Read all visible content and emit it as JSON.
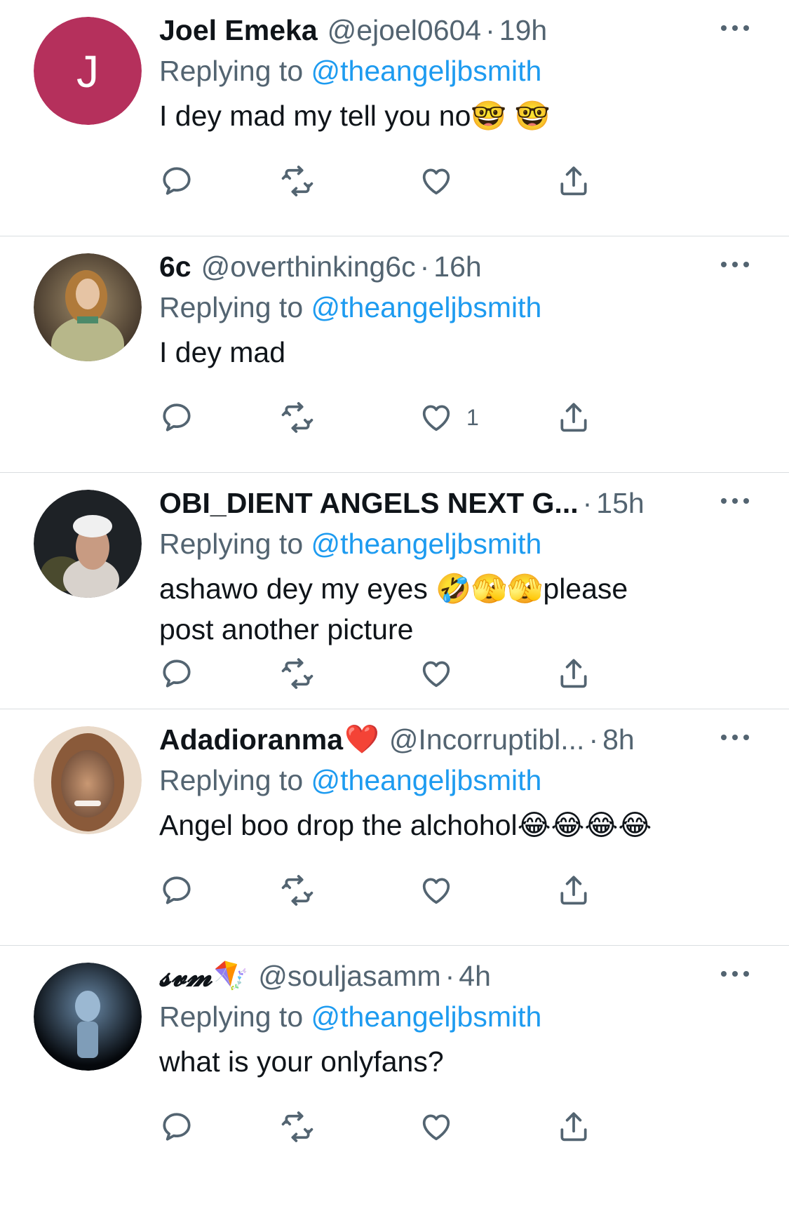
{
  "colors": {
    "accent": "#1d9bf0",
    "secondary_text": "#536471",
    "primary_text": "#0f1419",
    "divider": "#d9dde0",
    "avatar_j": "#b5305c"
  },
  "tweets": [
    {
      "name": "Joel Emeka",
      "name_emoji": "",
      "handle": "@ejoel0604",
      "separator": "·",
      "time": "19h",
      "replying_prefix": "Replying to ",
      "replying_to": "@theangeljbsmith",
      "text": "I dey mad my tell you no🤓 🤓",
      "avatar_letter": "J",
      "like_count": ""
    },
    {
      "name": "6c",
      "name_emoji": "",
      "handle": "@overthinking6c",
      "separator": "·",
      "time": "16h",
      "replying_prefix": "Replying to ",
      "replying_to": "@theangeljbsmith",
      "text": "I dey mad",
      "avatar_letter": "",
      "like_count": "1"
    },
    {
      "name": "OBI_DIENT ANGELS NEXT G...",
      "name_emoji": "",
      "handle": "",
      "separator": "·",
      "time": "15h",
      "replying_prefix": "Replying to ",
      "replying_to": "@theangeljbsmith",
      "text": "ashawo dey my eyes 🤣🫣🫣please post another picture",
      "avatar_letter": "",
      "like_count": ""
    },
    {
      "name": "Adadioranma",
      "name_emoji": "❤️",
      "handle": "@Incorruptibl...",
      "separator": "·",
      "time": "8h",
      "replying_prefix": "Replying to ",
      "replying_to": "@theangeljbsmith",
      "text": "Angel boo drop the alchohol😂😂😂😂",
      "avatar_letter": "",
      "like_count": ""
    },
    {
      "name": "𝓼𝓿𝓶",
      "name_emoji": "🪁",
      "handle": "@souljasamm",
      "separator": "·",
      "time": "4h",
      "replying_prefix": "Replying to ",
      "replying_to": "@theangeljbsmith",
      "text": "what is your onlyfans?",
      "avatar_letter": "",
      "like_count": ""
    }
  ],
  "icons": {
    "reply": "reply-icon",
    "retweet": "retweet-icon",
    "like": "heart-icon",
    "share": "share-icon",
    "more": "more-options-icon"
  }
}
